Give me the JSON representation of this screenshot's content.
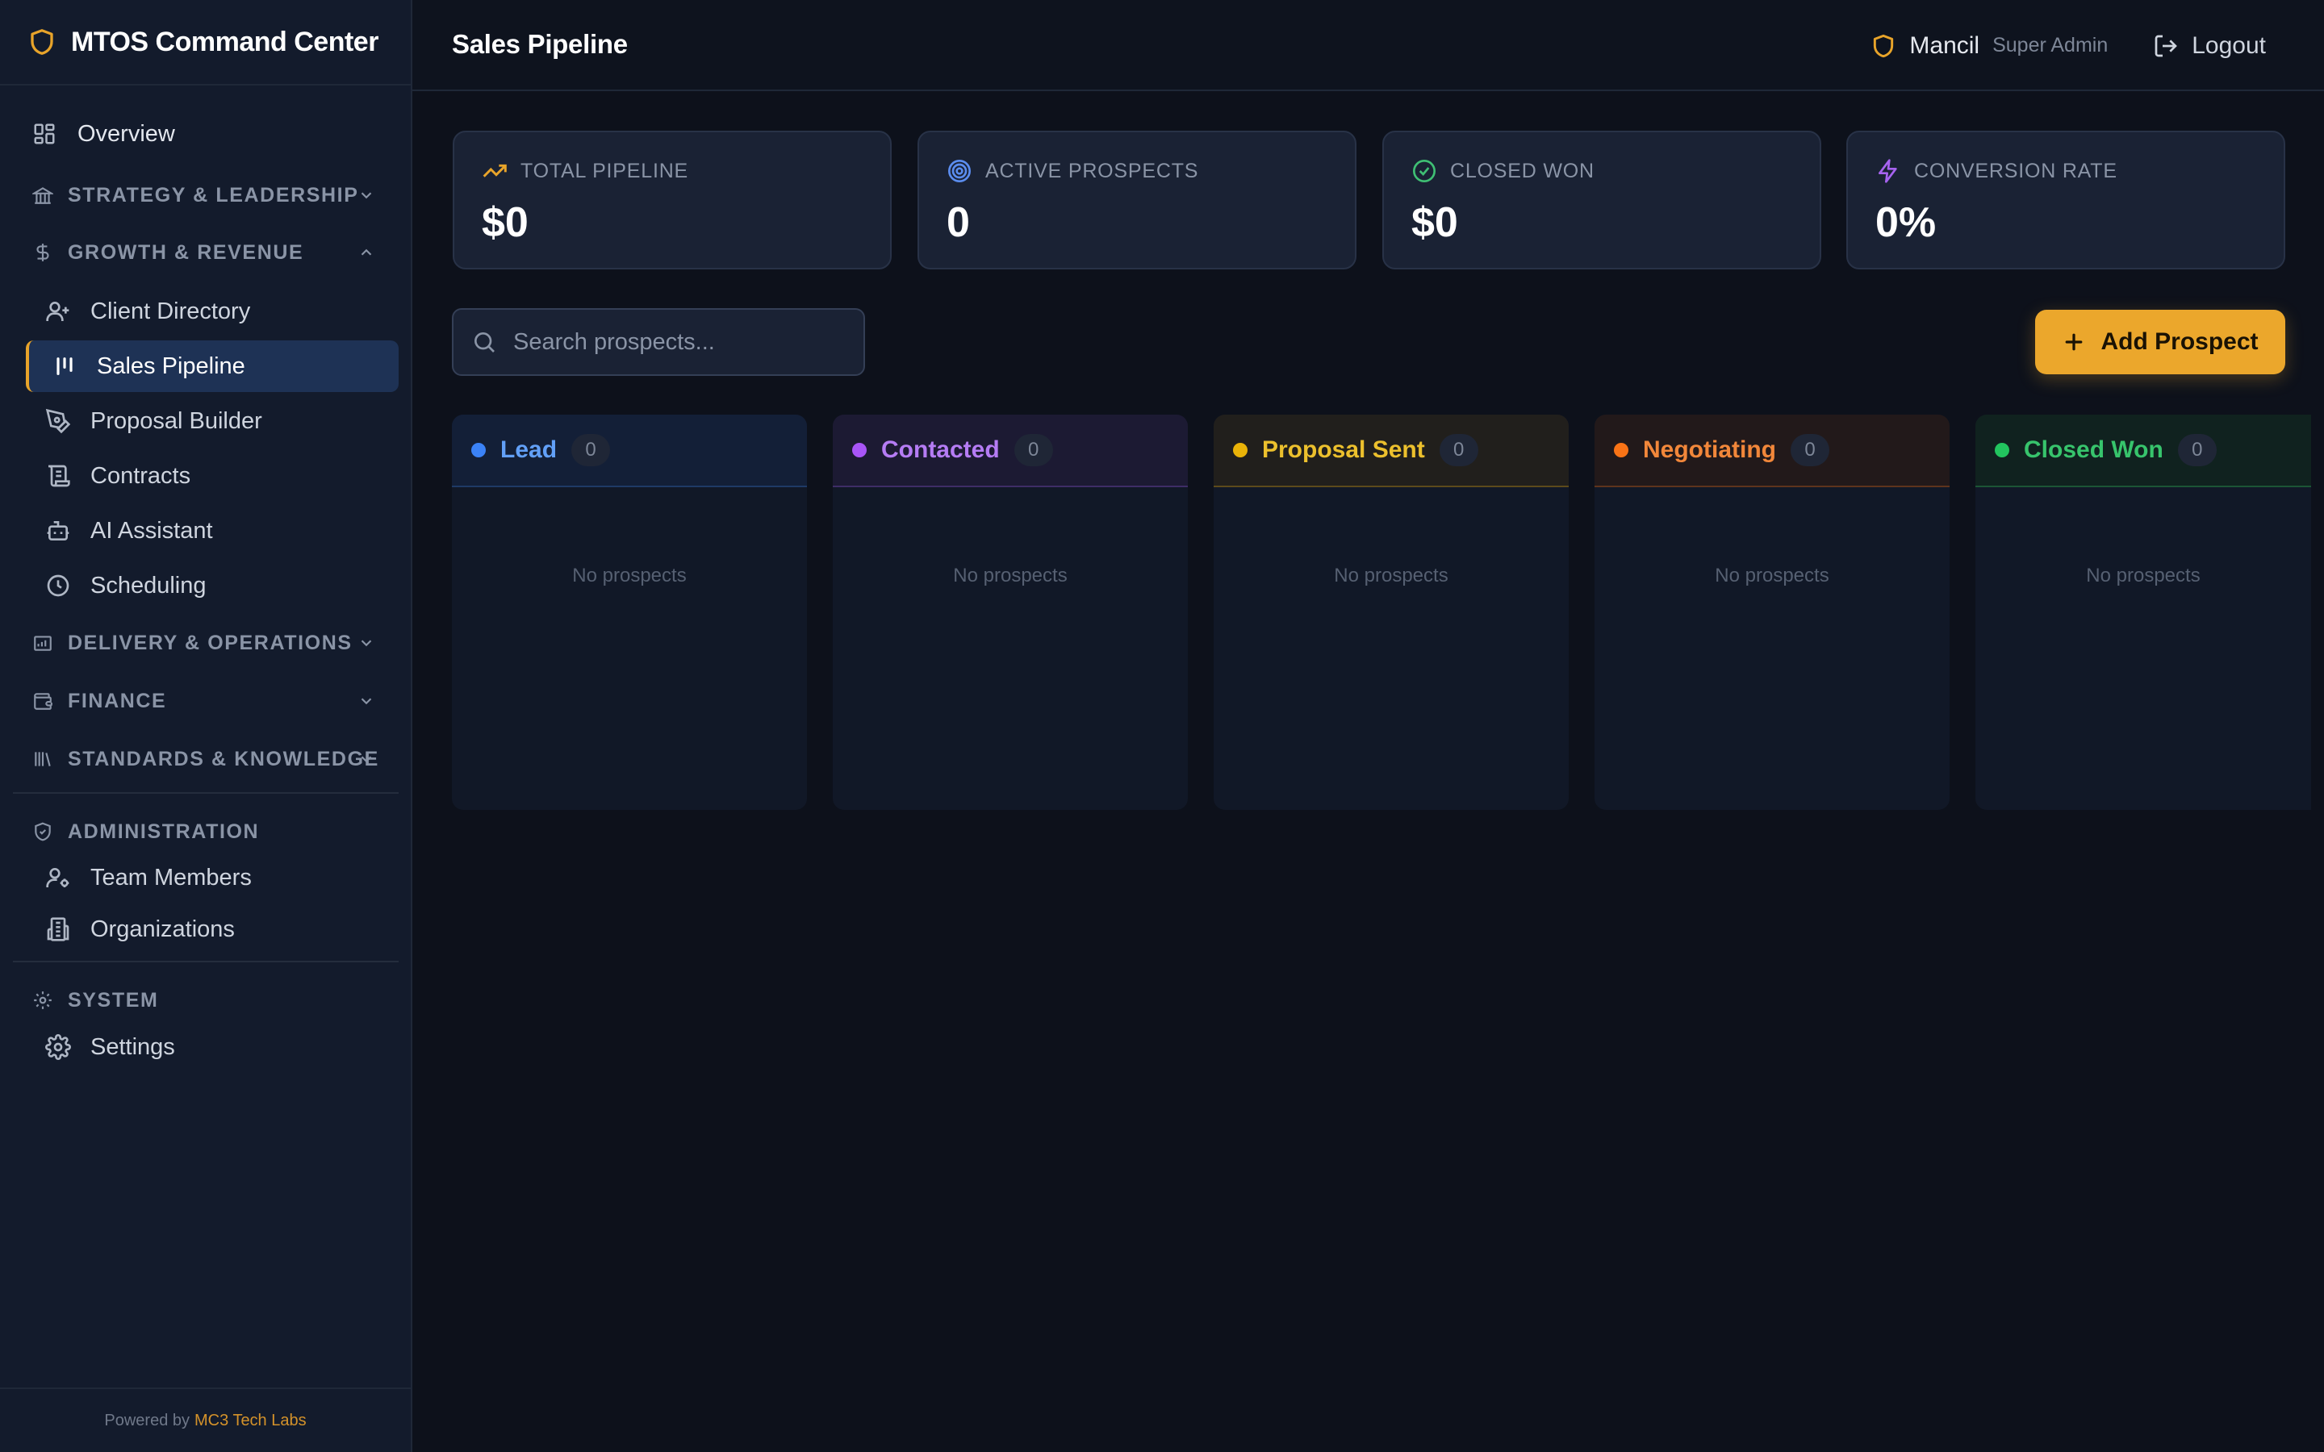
{
  "brand": {
    "name": "MTOS Command Center"
  },
  "sidebar": {
    "overview": "Overview",
    "sections": {
      "strategy": "STRATEGY & LEADERSHIP",
      "growth": "GROWTH & REVENUE",
      "delivery": "DELIVERY & OPERATIONS",
      "finance": "FINANCE",
      "standards": "STANDARDS & KNOWLEDGE",
      "administration": "ADMINISTRATION",
      "system": "SYSTEM"
    },
    "growth_items": [
      "Client Directory",
      "Sales Pipeline",
      "Proposal Builder",
      "Contracts",
      "AI Assistant",
      "Scheduling"
    ],
    "admin_items": [
      "Team Members",
      "Organizations"
    ],
    "system_items": [
      "Settings"
    ],
    "powered_by": "Powered by",
    "powered_brand": "MC3 Tech Labs"
  },
  "header": {
    "title": "Sales Pipeline",
    "user_name": "Mancil",
    "user_role": "Super Admin",
    "logout": "Logout"
  },
  "stats": [
    {
      "label": "TOTAL PIPELINE",
      "value": "$0",
      "icon": "trending-up-icon",
      "color": "#e8a42a"
    },
    {
      "label": "ACTIVE PROSPECTS",
      "value": "0",
      "icon": "target-icon",
      "color": "#5b8def"
    },
    {
      "label": "CLOSED WON",
      "value": "$0",
      "icon": "check-circle-icon",
      "color": "#3fbf74"
    },
    {
      "label": "CONVERSION RATE",
      "value": "0%",
      "icon": "zap-icon",
      "color": "#a763f0"
    }
  ],
  "toolbar": {
    "search_placeholder": "Search prospects...",
    "search_value": "",
    "add_label": "Add Prospect"
  },
  "pipeline": {
    "columns": [
      {
        "name": "Lead",
        "count": "0",
        "empty": "No prospects",
        "color": "#3b82f6"
      },
      {
        "name": "Contacted",
        "count": "0",
        "empty": "No prospects",
        "color": "#a855f7"
      },
      {
        "name": "Proposal Sent",
        "count": "0",
        "empty": "No prospects",
        "color": "#eab308"
      },
      {
        "name": "Negotiating",
        "count": "0",
        "empty": "No prospects",
        "color": "#f97316"
      },
      {
        "name": "Closed Won",
        "count": "0",
        "empty": "No prospects",
        "color": "#22c55e"
      }
    ]
  },
  "colors": {
    "accent": "#eba72c",
    "sidebar_bg": "#131b2c",
    "page_bg": "#0d111b",
    "active_item": "#1e3255"
  }
}
